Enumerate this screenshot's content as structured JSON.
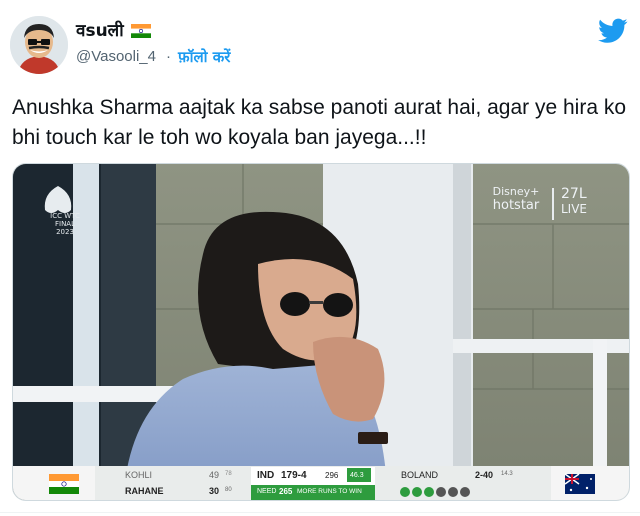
{
  "user": {
    "name": "वsuली",
    "handle": "@Vasooli_4",
    "separator": "·",
    "follow_label": "फ़ॉलो करें",
    "flag_icon": "india-flag-icon",
    "avatar_icon": "cartoon-avatar-icon"
  },
  "tweet": {
    "text": "Anushka Sharma aajtak ka sabse panoti aurat hai, agar ye hira ko bhi touch kar le toh wo koyala ban jayega...!!"
  },
  "media": {
    "event_logo": {
      "line1": "ICC WTC",
      "line2": "FINAL 2023"
    },
    "broadcaster": {
      "brand_top": "Disney+",
      "brand_bottom": "hotstar",
      "viewers": "27L",
      "live": "LIVE"
    },
    "scorebar": {
      "batter1_name": "KOHLI",
      "batter1_runs": "49",
      "batter1_balls": "78",
      "batter2_name": "RAHANE",
      "batter2_runs": "30",
      "batter2_balls": "80",
      "team": "IND",
      "score": "179-4",
      "target_label": "296",
      "overs": "46.3",
      "need_label": "NEED",
      "need_runs": "265",
      "need_text": "MORE RUNS TO WIN",
      "bowler_name": "BOLAND",
      "bowler_figures": "2-40",
      "bowler_overs": "14.3"
    }
  },
  "colors": {
    "twitter_blue": "#1d9bf0",
    "text": "#0f1419",
    "secondary": "#536471",
    "scorebar_green": "#2e9c3e"
  }
}
